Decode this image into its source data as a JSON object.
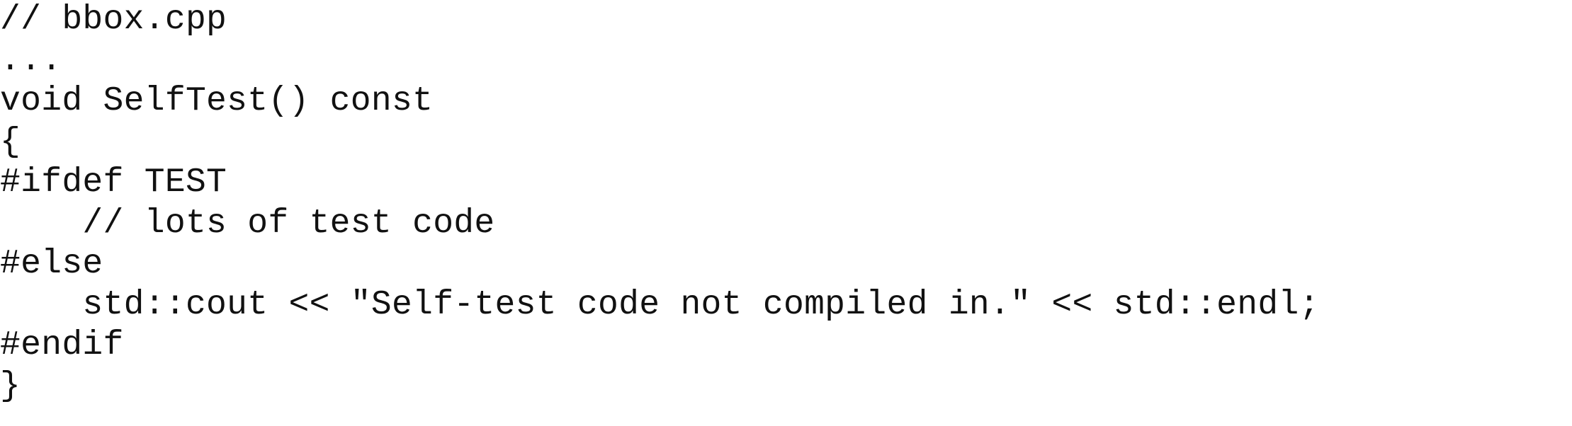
{
  "code": {
    "lines": [
      "// bbox.cpp",
      "...",
      "void SelfTest() const",
      "{",
      "#ifdef TEST",
      "    // lots of test code",
      "#else",
      "    std::cout << \"Self-test code not compiled in.\" << std::endl;",
      "#endif",
      "}"
    ]
  }
}
